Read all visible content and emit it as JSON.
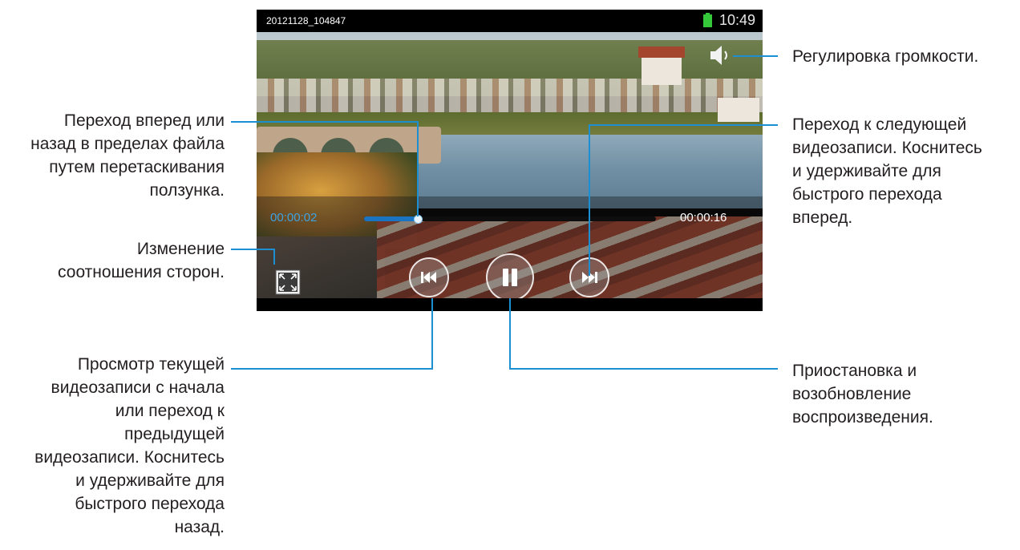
{
  "screen": {
    "file_title": "20121128_104847",
    "clock": "10:49",
    "current_time": "00:00:02",
    "total_time": "00:00:16",
    "progress": 0.185
  },
  "callouts": {
    "seek": "Переход вперед или\nназад в пределах файла\nпутем перетаскивания\nползунка.",
    "aspect": "Изменение\nсоотношения сторон.",
    "previous": "Просмотр текущей\nвидеозаписи с начала\nили переход к\nпредыдущей\nвидеозаписи. Коснитесь\nи удерживайте для\nбыстрого перехода\nназад.",
    "volume": "Регулировка громкости.",
    "next": "Переход к следующей\nвидеозаписи. Коснитесь\nи удерживайте для\nбыстрого перехода\nвперед.",
    "pause": "Приостановка и\nвозобновление\nвоспроизведения."
  },
  "icons": {
    "battery": "battery-icon",
    "volume": "volume-icon",
    "aspect": "aspect-ratio-icon",
    "previous": "previous-track-icon",
    "pause": "pause-icon",
    "next": "next-track-icon"
  },
  "colors": {
    "leader_line": "#1b8fd1",
    "progress_fill": "#1b74c2",
    "current_time": "#3da2e2",
    "battery": "#35c83a"
  }
}
